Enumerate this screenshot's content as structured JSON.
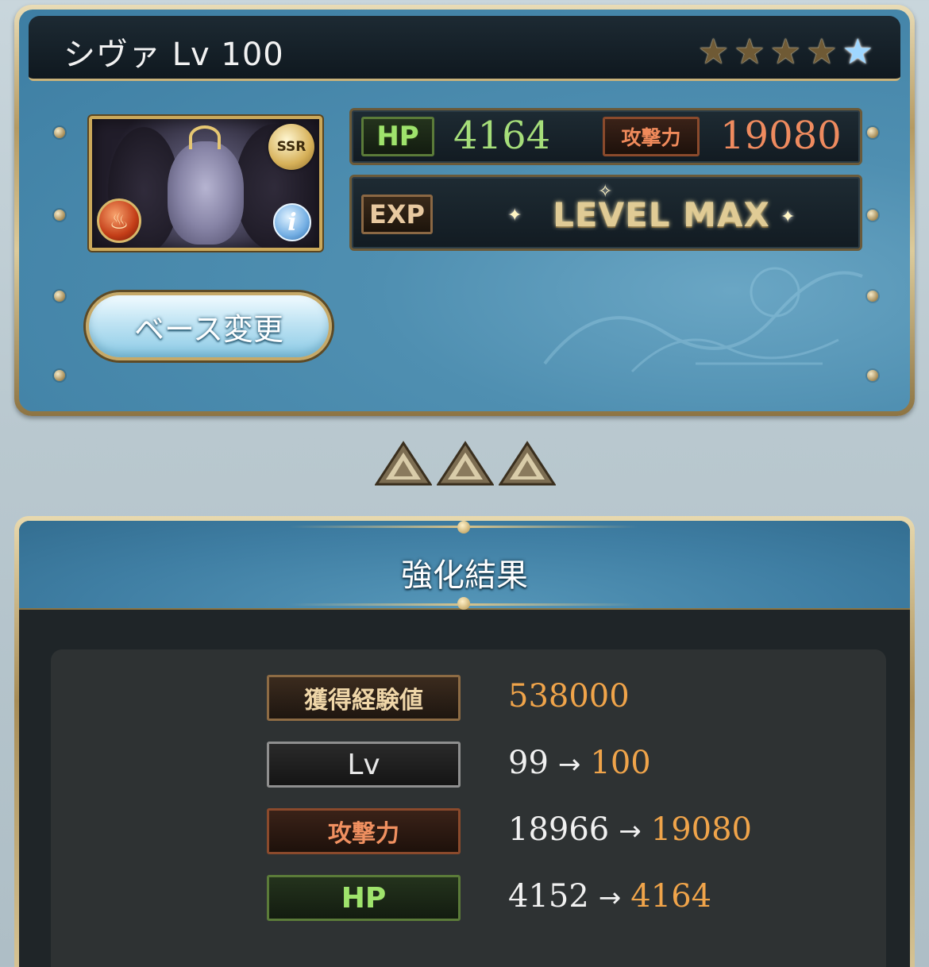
{
  "card": {
    "title": "シヴァ Lv 100",
    "stars": [
      "★",
      "★",
      "★",
      "★",
      "★"
    ],
    "rarity": "SSR",
    "element_icon": "fire-element-icon",
    "hp_label": "HP",
    "hp_value": "4164",
    "atk_label": "攻撃力",
    "atk_value": "19080",
    "exp_label": "EXP",
    "exp_status": "LEVEL MAX",
    "base_change_button": "ベース変更"
  },
  "result": {
    "title": "強化結果",
    "rows": [
      {
        "label": "獲得経験値",
        "old": "",
        "new": "538000"
      },
      {
        "label": "Lv",
        "old": "99",
        "new": "100"
      },
      {
        "label": "攻撃力",
        "old": "18966",
        "new": "19080"
      },
      {
        "label": "HP",
        "old": "4152",
        "new": "4164"
      }
    ]
  },
  "colors": {
    "hp": "#9fe36c",
    "atk": "#ef8b5f",
    "new_value": "#f0a44a",
    "panel_blue": "#4f8fb1",
    "gold_frame": "#c9b27a"
  }
}
